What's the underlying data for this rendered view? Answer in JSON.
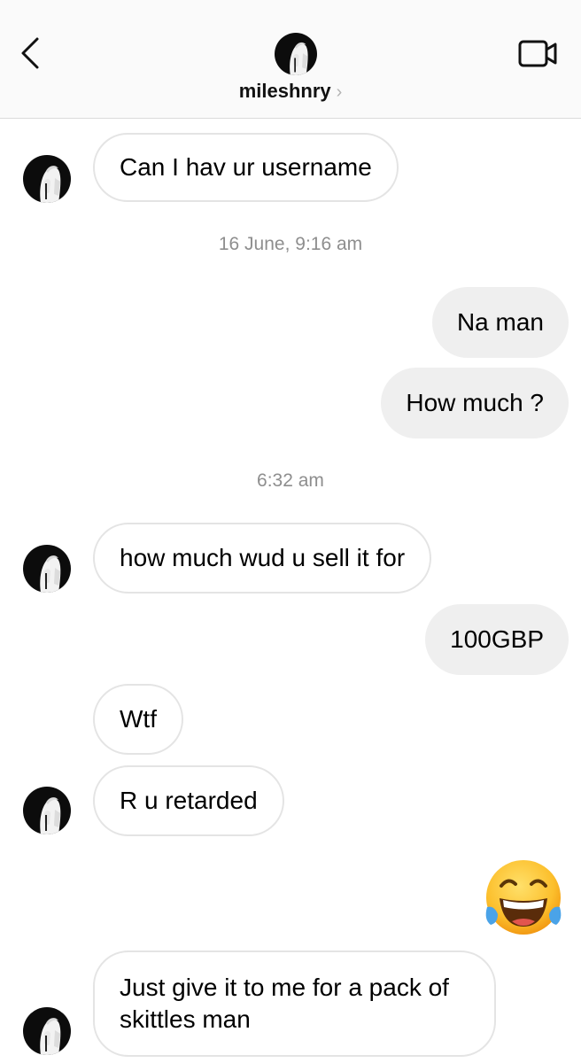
{
  "header": {
    "username": "mileshnry",
    "chevron": "›",
    "back_icon": "chevron-left-icon",
    "video_icon": "video-camera-icon"
  },
  "messages": [
    {
      "side": "incoming",
      "text": "Can I hav ur username"
    },
    {
      "timestamp": "16 June, 9:16 am"
    },
    {
      "side": "outgoing",
      "text": "Na man"
    },
    {
      "side": "outgoing",
      "text": "How much ?"
    },
    {
      "timestamp": "6:32 am"
    },
    {
      "side": "incoming",
      "text": "how much wud u sell it for"
    },
    {
      "side": "outgoing",
      "text": "100GBP"
    },
    {
      "side": "incoming",
      "text": "Wtf"
    },
    {
      "side": "incoming",
      "text": "R u retarded"
    },
    {
      "side": "outgoing",
      "emoji": "face-with-tears-of-joy"
    },
    {
      "side": "incoming",
      "text": "Just give it to me for a pack of skittles man"
    }
  ],
  "colors": {
    "incoming_border": "#e4e4e4",
    "outgoing_bg": "#efefef",
    "timestamp": "#8e8e8e",
    "header_bg": "#fafafa"
  }
}
